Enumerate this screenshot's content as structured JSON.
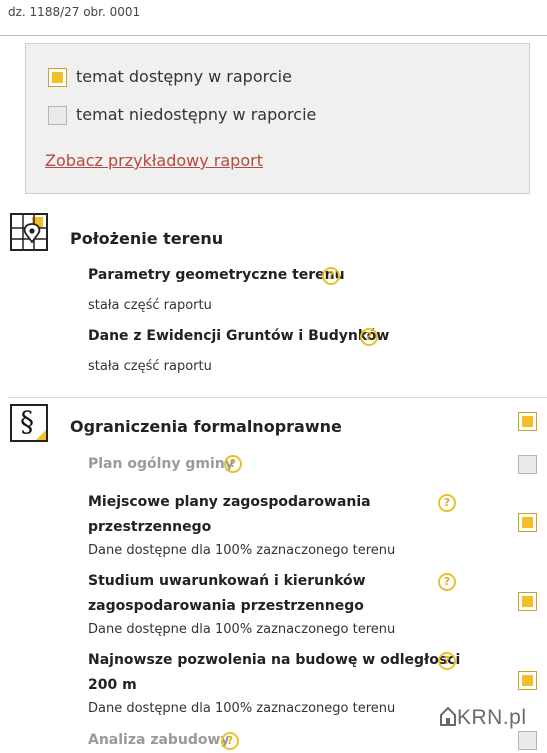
{
  "header": {
    "parcel_label": "dz. 1188/27 obr. 0001"
  },
  "legend": {
    "available_label": "temat dostępny w raporcie",
    "unavailable_label": "temat niedostępny w raporcie",
    "sample_link": "Zobacz przykładowy raport"
  },
  "sections": [
    {
      "title": "Położenie terenu",
      "icon": "map-pin-icon",
      "items": [
        {
          "title": "Parametry geometryczne terenu",
          "note": "stała część raportu"
        },
        {
          "title": "Dane z Ewidencji Gruntów i Budynków",
          "note": "stała część raportu"
        }
      ]
    },
    {
      "title": "Ograniczenia formalnoprawne",
      "icon": "paragraph-icon",
      "icon_glyph": "§",
      "selected": true,
      "items": [
        {
          "title": "Plan ogólny gminy",
          "selected": false,
          "available": false
        },
        {
          "title_line1": "Miejscowe plany zagospodarowania",
          "title_line2": "przestrzennego",
          "note": "Dane dostępne dla 100% zaznaczonego terenu",
          "selected": true
        },
        {
          "title_line1": "Studium uwarunkowań i kierunków",
          "title_line2": "zagospodarowania przestrzennego",
          "note": "Dane dostępne dla 100% zaznaczonego terenu",
          "selected": true
        },
        {
          "title_line1": "Najnowsze pozwolenia na budowę w odległości",
          "title_line2": "200 m",
          "note": "Dane dostępne dla 100% zaznaczonego terenu",
          "selected": true
        },
        {
          "title": "Analiza zabudowy",
          "selected": false,
          "available": false
        }
      ]
    }
  ],
  "help_glyph": "?",
  "watermark": "KRN.pl",
  "colors": {
    "accent": "#f2bf2a",
    "link": "#b9473e",
    "muted": "#9a9a9a"
  }
}
